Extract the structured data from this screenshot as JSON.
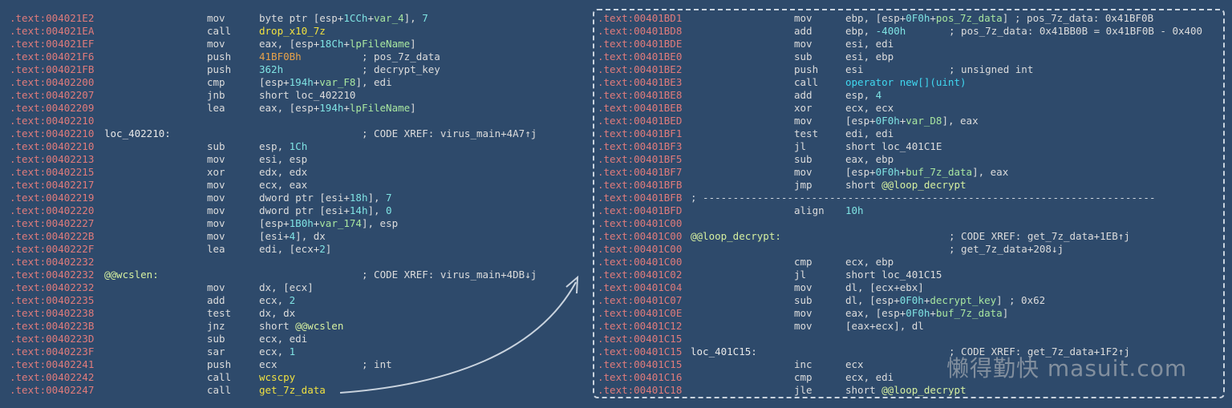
{
  "left_lines": [
    {
      "addr": ".text:004021E2",
      "label": "",
      "mnem": "mov",
      "ops": [
        [
          "byte ptr [esp+",
          ""
        ],
        [
          "1CCh",
          "t-num"
        ],
        [
          "+",
          ""
        ],
        [
          "var_4",
          "t-var"
        ],
        [
          "], ",
          ""
        ],
        [
          "7",
          "t-num"
        ]
      ],
      "cmt": ""
    },
    {
      "addr": ".text:004021EA",
      "label": "",
      "mnem": "call",
      "ops": [
        [
          "drop_x10_7z",
          "t-fn"
        ]
      ],
      "cmt": ""
    },
    {
      "addr": ".text:004021EF",
      "label": "",
      "mnem": "mov",
      "ops": [
        [
          "eax, [esp+",
          ""
        ],
        [
          "18Ch",
          "t-num"
        ],
        [
          "+",
          ""
        ],
        [
          "lpFileName",
          "t-var"
        ],
        [
          "]",
          ""
        ]
      ],
      "cmt": ""
    },
    {
      "addr": ".text:004021F6",
      "label": "",
      "mnem": "push",
      "ops": [
        [
          "41BF0Bh",
          "t-str"
        ]
      ],
      "cmt": "; pos_7z_data"
    },
    {
      "addr": ".text:004021FB",
      "label": "",
      "mnem": "push",
      "ops": [
        [
          "362h",
          "t-num"
        ]
      ],
      "cmt": "; decrypt_key"
    },
    {
      "addr": ".text:00402200",
      "label": "",
      "mnem": "cmp",
      "ops": [
        [
          "[esp+",
          ""
        ],
        [
          "194h",
          "t-num"
        ],
        [
          "+",
          ""
        ],
        [
          "var_F8",
          "t-var"
        ],
        [
          "], edi",
          ""
        ]
      ],
      "cmt": ""
    },
    {
      "addr": ".text:00402207",
      "label": "",
      "mnem": "jnb",
      "ops": [
        [
          "short loc_402210",
          ""
        ]
      ],
      "cmt": ""
    },
    {
      "addr": ".text:00402209",
      "label": "",
      "mnem": "lea",
      "ops": [
        [
          "eax, [esp+",
          ""
        ],
        [
          "194h",
          "t-num"
        ],
        [
          "+",
          ""
        ],
        [
          "lpFileName",
          "t-var"
        ],
        [
          "]",
          ""
        ]
      ],
      "cmt": ""
    },
    {
      "addr": ".text:00402210",
      "label": "",
      "mnem": "",
      "ops": [],
      "cmt": ""
    },
    {
      "addr": ".text:00402210",
      "label": "loc_402210:",
      "hl": false,
      "mnem": "",
      "ops": [],
      "cmt": "; CODE XREF: virus_main+4A7↑j"
    },
    {
      "addr": ".text:00402210",
      "label": "",
      "mnem": "sub",
      "ops": [
        [
          "esp, ",
          ""
        ],
        [
          "1Ch",
          "t-num"
        ]
      ],
      "cmt": ""
    },
    {
      "addr": ".text:00402213",
      "label": "",
      "mnem": "mov",
      "ops": [
        [
          "esi, esp",
          ""
        ]
      ],
      "cmt": ""
    },
    {
      "addr": ".text:00402215",
      "label": "",
      "mnem": "xor",
      "ops": [
        [
          "edx, edx",
          ""
        ]
      ],
      "cmt": ""
    },
    {
      "addr": ".text:00402217",
      "label": "",
      "mnem": "mov",
      "ops": [
        [
          "ecx, eax",
          ""
        ]
      ],
      "cmt": ""
    },
    {
      "addr": ".text:00402219",
      "label": "",
      "mnem": "mov",
      "ops": [
        [
          "dword ptr [esi+",
          ""
        ],
        [
          "18h",
          "t-num"
        ],
        [
          "], ",
          ""
        ],
        [
          "7",
          "t-num"
        ]
      ],
      "cmt": ""
    },
    {
      "addr": ".text:00402220",
      "label": "",
      "mnem": "mov",
      "ops": [
        [
          "dword ptr [esi+",
          ""
        ],
        [
          "14h",
          "t-num"
        ],
        [
          "], ",
          ""
        ],
        [
          "0",
          "t-num"
        ]
      ],
      "cmt": ""
    },
    {
      "addr": ".text:00402227",
      "label": "",
      "mnem": "mov",
      "ops": [
        [
          "[esp+",
          ""
        ],
        [
          "1B0h",
          "t-num"
        ],
        [
          "+",
          ""
        ],
        [
          "var_174",
          "t-var"
        ],
        [
          "], esp",
          ""
        ]
      ],
      "cmt": ""
    },
    {
      "addr": ".text:0040222B",
      "label": "",
      "mnem": "mov",
      "ops": [
        [
          "[esi+",
          ""
        ],
        [
          "4",
          "t-num"
        ],
        [
          "], dx",
          ""
        ]
      ],
      "cmt": ""
    },
    {
      "addr": ".text:0040222F",
      "label": "",
      "mnem": "lea",
      "ops": [
        [
          "edi, [ecx+",
          ""
        ],
        [
          "2",
          "t-num"
        ],
        [
          "]",
          ""
        ]
      ],
      "cmt": ""
    },
    {
      "addr": ".text:00402232",
      "label": "",
      "mnem": "",
      "ops": [],
      "cmt": ""
    },
    {
      "addr": ".text:00402232",
      "label": "@@wcslen:",
      "hl": true,
      "mnem": "",
      "ops": [],
      "cmt": "; CODE XREF: virus_main+4DB↓j"
    },
    {
      "addr": ".text:00402232",
      "label": "",
      "mnem": "mov",
      "ops": [
        [
          "dx, [ecx]",
          ""
        ]
      ],
      "cmt": ""
    },
    {
      "addr": ".text:00402235",
      "label": "",
      "mnem": "add",
      "ops": [
        [
          "ecx, ",
          ""
        ],
        [
          "2",
          "t-num"
        ]
      ],
      "cmt": ""
    },
    {
      "addr": ".text:00402238",
      "label": "",
      "mnem": "test",
      "ops": [
        [
          "dx, dx",
          ""
        ]
      ],
      "cmt": ""
    },
    {
      "addr": ".text:0040223B",
      "label": "",
      "mnem": "jnz",
      "ops": [
        [
          "short ",
          ""
        ],
        [
          "@@wcslen",
          "t-loc"
        ]
      ],
      "cmt": ""
    },
    {
      "addr": ".text:0040223D",
      "label": "",
      "mnem": "sub",
      "ops": [
        [
          "ecx, edi",
          ""
        ]
      ],
      "cmt": ""
    },
    {
      "addr": ".text:0040223F",
      "label": "",
      "mnem": "sar",
      "ops": [
        [
          "ecx, ",
          ""
        ],
        [
          "1",
          "t-num"
        ]
      ],
      "cmt": ""
    },
    {
      "addr": ".text:00402241",
      "label": "",
      "mnem": "push",
      "ops": [
        [
          "ecx",
          ""
        ]
      ],
      "cmt": "; int"
    },
    {
      "addr": ".text:00402242",
      "label": "",
      "mnem": "call",
      "ops": [
        [
          "wcscpy",
          "t-fn"
        ]
      ],
      "cmt": ""
    },
    {
      "addr": ".text:00402247",
      "label": "",
      "mnem": "call",
      "ops": [
        [
          "get_7z_data",
          "t-fn"
        ]
      ],
      "cmt": ""
    }
  ],
  "right_lines": [
    {
      "addr": ".text:00401BD1",
      "label": "",
      "mnem": "mov",
      "ops": [
        [
          "ebp, [esp+",
          ""
        ],
        [
          "0F0h",
          "t-num"
        ],
        [
          "+",
          ""
        ],
        [
          "pos_7z_data",
          "t-var"
        ],
        [
          "]",
          ""
        ]
      ],
      "cmt": "; pos_7z_data: 0x41BF0B"
    },
    {
      "addr": ".text:00401BD8",
      "label": "",
      "mnem": "add",
      "ops": [
        [
          "ebp, ",
          ""
        ],
        [
          "-400h",
          "t-num"
        ]
      ],
      "cmt": "; pos_7z_data: 0x41BB0B = 0x41BF0B - 0x400"
    },
    {
      "addr": ".text:00401BDE",
      "label": "",
      "mnem": "mov",
      "ops": [
        [
          "esi, edi",
          ""
        ]
      ],
      "cmt": ""
    },
    {
      "addr": ".text:00401BE0",
      "label": "",
      "mnem": "sub",
      "ops": [
        [
          "esi, ebp",
          ""
        ]
      ],
      "cmt": ""
    },
    {
      "addr": ".text:00401BE2",
      "label": "",
      "mnem": "push",
      "ops": [
        [
          "esi",
          ""
        ]
      ],
      "cmt": "; unsigned int"
    },
    {
      "addr": ".text:00401BE3",
      "label": "",
      "mnem": "call",
      "ops": [
        [
          "operator new[](uint)",
          "t-api"
        ]
      ],
      "cmt": ""
    },
    {
      "addr": ".text:00401BE8",
      "label": "",
      "mnem": "add",
      "ops": [
        [
          "esp, ",
          ""
        ],
        [
          "4",
          "t-num"
        ]
      ],
      "cmt": ""
    },
    {
      "addr": ".text:00401BEB",
      "label": "",
      "mnem": "xor",
      "ops": [
        [
          "ecx, ecx",
          ""
        ]
      ],
      "cmt": ""
    },
    {
      "addr": ".text:00401BED",
      "label": "",
      "mnem": "mov",
      "ops": [
        [
          "[esp+",
          ""
        ],
        [
          "0F0h",
          "t-num"
        ],
        [
          "+",
          ""
        ],
        [
          "var_D8",
          "t-var"
        ],
        [
          "], eax",
          ""
        ]
      ],
      "cmt": ""
    },
    {
      "addr": ".text:00401BF1",
      "label": "",
      "mnem": "test",
      "ops": [
        [
          "edi, edi",
          ""
        ]
      ],
      "cmt": ""
    },
    {
      "addr": ".text:00401BF3",
      "label": "",
      "mnem": "jl",
      "ops": [
        [
          "short loc_401C1E",
          ""
        ]
      ],
      "cmt": ""
    },
    {
      "addr": ".text:00401BF5",
      "label": "",
      "mnem": "sub",
      "ops": [
        [
          "eax, ebp",
          ""
        ]
      ],
      "cmt": ""
    },
    {
      "addr": ".text:00401BF7",
      "label": "",
      "mnem": "mov",
      "ops": [
        [
          "[esp+",
          ""
        ],
        [
          "0F0h",
          "t-num"
        ],
        [
          "+",
          ""
        ],
        [
          "buf_7z_data",
          "t-var"
        ],
        [
          "], eax",
          ""
        ]
      ],
      "cmt": ""
    },
    {
      "addr": ".text:00401BFB",
      "label": "",
      "mnem": "jmp",
      "ops": [
        [
          "short ",
          ""
        ],
        [
          "@@loop_decrypt",
          "t-loc"
        ]
      ],
      "cmt": ""
    },
    {
      "addr": ".text:00401BFB",
      "sep": true,
      "sep_text": "; ---------------------------------------------------------------------------"
    },
    {
      "addr": ".text:00401BFD",
      "label": "",
      "mnem": "align",
      "ops": [
        [
          "10h",
          "t-num"
        ]
      ],
      "cmt": ""
    },
    {
      "addr": ".text:00401C00",
      "label": "",
      "mnem": "",
      "ops": [],
      "cmt": ""
    },
    {
      "addr": ".text:00401C00",
      "label": "@@loop_decrypt:",
      "hl": true,
      "mnem": "",
      "ops": [],
      "cmt": "; CODE XREF: get_7z_data+1EB↑j"
    },
    {
      "addr": ".text:00401C00",
      "label": "",
      "mnem": "",
      "ops": [],
      "cmt": "; get_7z_data+208↓j"
    },
    {
      "addr": ".text:00401C00",
      "label": "",
      "mnem": "cmp",
      "ops": [
        [
          "ecx, ebp",
          ""
        ]
      ],
      "cmt": ""
    },
    {
      "addr": ".text:00401C02",
      "label": "",
      "mnem": "jl",
      "ops": [
        [
          "short loc_401C15",
          ""
        ]
      ],
      "cmt": ""
    },
    {
      "addr": ".text:00401C04",
      "label": "",
      "mnem": "mov",
      "ops": [
        [
          "dl, [ecx+ebx]",
          ""
        ]
      ],
      "cmt": ""
    },
    {
      "addr": ".text:00401C07",
      "label": "",
      "mnem": "sub",
      "ops": [
        [
          "dl, [esp+",
          ""
        ],
        [
          "0F0h",
          "t-num"
        ],
        [
          "+",
          ""
        ],
        [
          "decrypt_key",
          "t-var"
        ],
        [
          "]",
          ""
        ]
      ],
      "cmt": "; 0x62",
      "cmt_col": "after"
    },
    {
      "addr": ".text:00401C0E",
      "label": "",
      "mnem": "mov",
      "ops": [
        [
          "eax, [esp+",
          ""
        ],
        [
          "0F0h",
          "t-num"
        ],
        [
          "+",
          ""
        ],
        [
          "buf_7z_data",
          "t-var"
        ],
        [
          "]",
          ""
        ]
      ],
      "cmt": ""
    },
    {
      "addr": ".text:00401C12",
      "label": "",
      "mnem": "mov",
      "ops": [
        [
          "[eax+ecx], dl",
          ""
        ]
      ],
      "cmt": ""
    },
    {
      "addr": ".text:00401C15",
      "label": "",
      "mnem": "",
      "ops": [],
      "cmt": ""
    },
    {
      "addr": ".text:00401C15",
      "label": "loc_401C15:",
      "hl": false,
      "mnem": "",
      "ops": [],
      "cmt": "; CODE XREF: get_7z_data+1F2↑j"
    },
    {
      "addr": ".text:00401C15",
      "label": "",
      "mnem": "inc",
      "ops": [
        [
          "ecx",
          ""
        ]
      ],
      "cmt": ""
    },
    {
      "addr": ".text:00401C16",
      "label": "",
      "mnem": "cmp",
      "ops": [
        [
          "ecx, edi",
          ""
        ]
      ],
      "cmt": ""
    },
    {
      "addr": ".text:00401C18",
      "label": "",
      "mnem": "jle",
      "ops": [
        [
          "short ",
          ""
        ],
        [
          "@@loop_decrypt",
          "t-loc"
        ]
      ],
      "cmt": ""
    }
  ],
  "watermark": "懒得勤快 masuit.com",
  "colors": {
    "background": "#2e4a6b",
    "address": "#e07b7b",
    "number": "#7fe3e3",
    "variable": "#a8e6a0",
    "function": "#f0e040"
  }
}
